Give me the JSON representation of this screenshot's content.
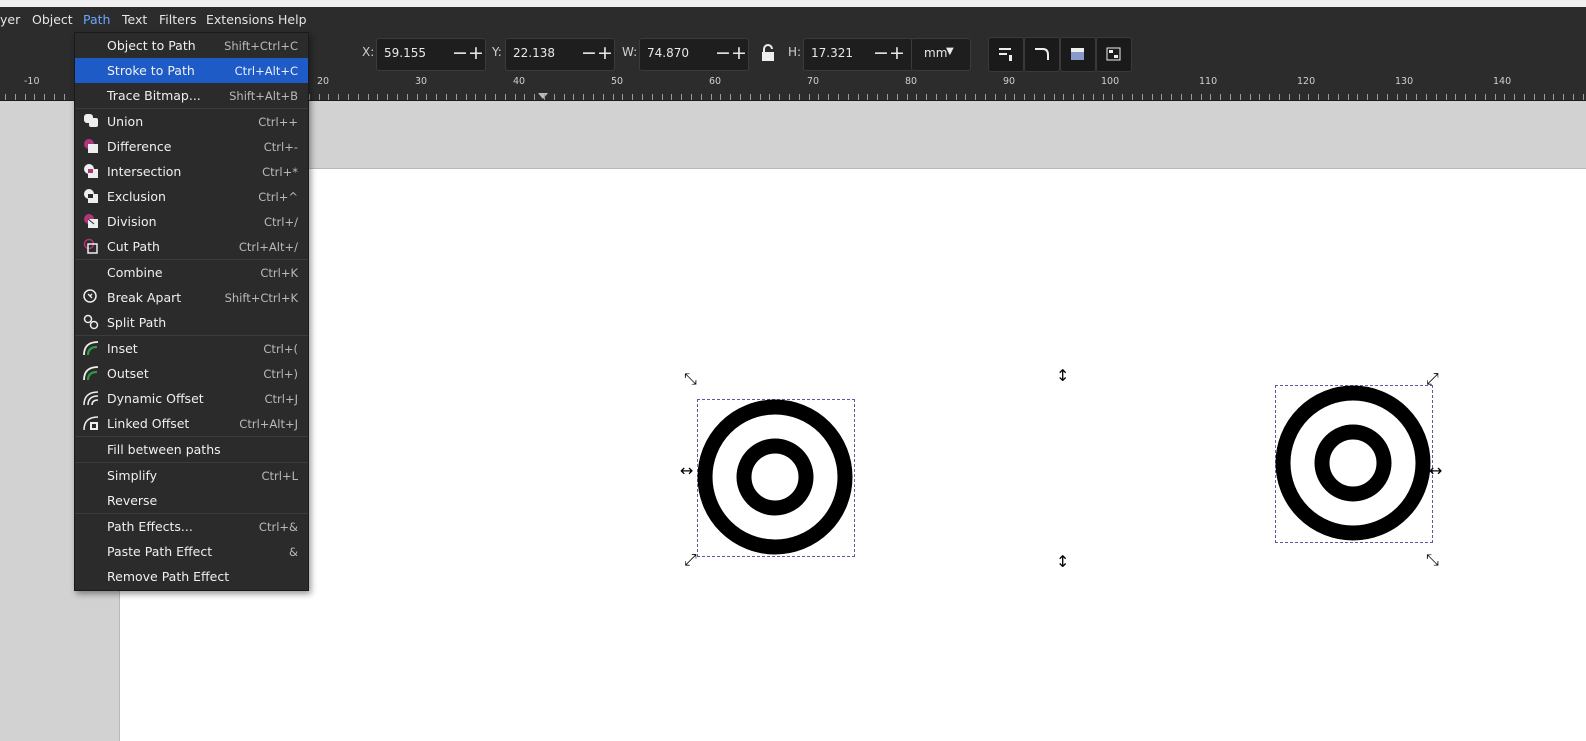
{
  "menubar": {
    "items": [
      {
        "label": "yer"
      },
      {
        "label": "Object"
      },
      {
        "label": "Path"
      },
      {
        "label": "Text"
      },
      {
        "label": "Filters"
      },
      {
        "label": "Extensions"
      },
      {
        "label": "Help"
      }
    ]
  },
  "toolbar": {
    "x_label": "X:",
    "x_value": "59.155",
    "y_label": "Y:",
    "y_value": "22.138",
    "w_label": "W:",
    "w_value": "74.870",
    "h_label": "H:",
    "h_value": "17.321",
    "unit": "mm"
  },
  "ruler": {
    "labels": [
      "-10",
      "20",
      "30",
      "40",
      "50",
      "60",
      "70",
      "80",
      "90",
      "100",
      "110",
      "120",
      "130",
      "140"
    ]
  },
  "path_menu": {
    "items": [
      {
        "label": "Object to Path",
        "shortcut": "Shift+Ctrl+C",
        "icon": ""
      },
      {
        "label": "Stroke to Path",
        "shortcut": "Ctrl+Alt+C",
        "icon": "",
        "highlighted": true
      },
      {
        "label": "Trace Bitmap...",
        "shortcut": "Shift+Alt+B",
        "icon": ""
      },
      {
        "label": "Union",
        "shortcut": "Ctrl++",
        "icon": "union-icon"
      },
      {
        "label": "Difference",
        "shortcut": "Ctrl+-",
        "icon": "difference-icon"
      },
      {
        "label": "Intersection",
        "shortcut": "Ctrl+*",
        "icon": "intersection-icon"
      },
      {
        "label": "Exclusion",
        "shortcut": "Ctrl+^",
        "icon": "exclusion-icon"
      },
      {
        "label": "Division",
        "shortcut": "Ctrl+/",
        "icon": "division-icon"
      },
      {
        "label": "Cut Path",
        "shortcut": "Ctrl+Alt+/",
        "icon": "cut-path-icon"
      },
      {
        "label": "Combine",
        "shortcut": "Ctrl+K",
        "icon": ""
      },
      {
        "label": "Break Apart",
        "shortcut": "Shift+Ctrl+K",
        "icon": "break-apart-icon"
      },
      {
        "label": "Split Path",
        "shortcut": "",
        "icon": "split-path-icon"
      },
      {
        "label": "Inset",
        "shortcut": "Ctrl+(",
        "icon": "inset-icon"
      },
      {
        "label": "Outset",
        "shortcut": "Ctrl+)",
        "icon": "outset-icon"
      },
      {
        "label": "Dynamic Offset",
        "shortcut": "Ctrl+J",
        "icon": "dynamic-offset-icon"
      },
      {
        "label": "Linked Offset",
        "shortcut": "Ctrl+Alt+J",
        "icon": "linked-offset-icon"
      },
      {
        "label": "Fill between paths",
        "shortcut": "",
        "icon": ""
      },
      {
        "label": "Simplify",
        "shortcut": "Ctrl+L",
        "icon": ""
      },
      {
        "label": "Reverse",
        "shortcut": "",
        "icon": ""
      },
      {
        "label": "Path Effects...",
        "shortcut": "Ctrl+&",
        "icon": ""
      },
      {
        "label": "Paste Path Effect",
        "shortcut": "&",
        "icon": ""
      },
      {
        "label": "Remove Path Effect",
        "shortcut": "",
        "icon": ""
      }
    ]
  }
}
